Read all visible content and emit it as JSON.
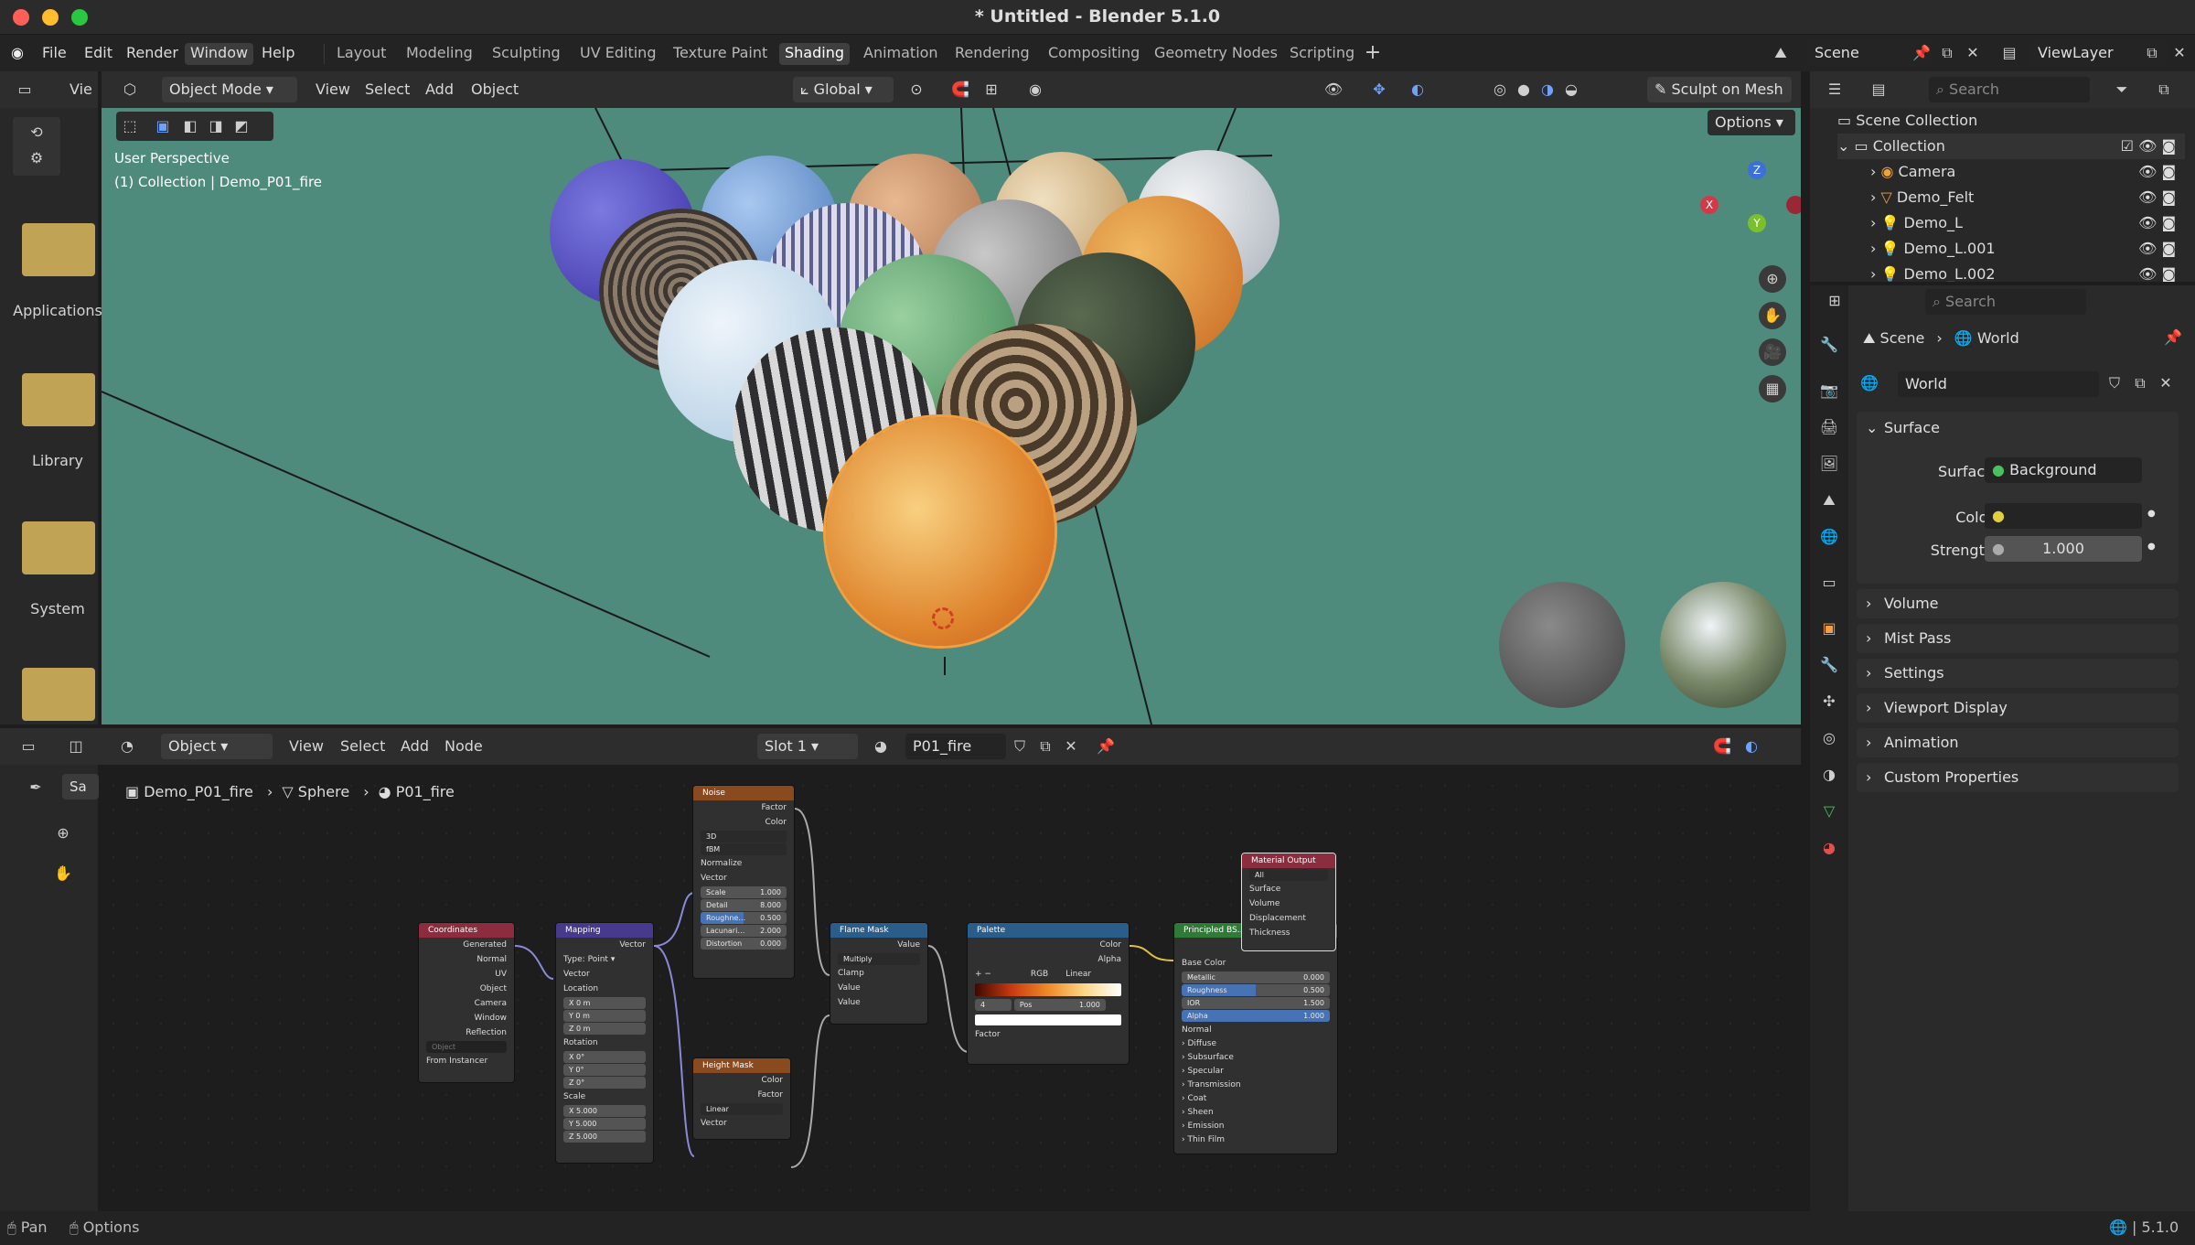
{
  "window": {
    "title": "* Untitled - Blender 5.1.0"
  },
  "menu": {
    "items": [
      "File",
      "Edit",
      "Render",
      "Window",
      "Help"
    ],
    "active": "Window"
  },
  "workspaces": [
    "Layout",
    "Modeling",
    "Sculpting",
    "UV Editing",
    "Texture Paint",
    "Shading",
    "Animation",
    "Rendering",
    "Compositing",
    "Geometry Nodes",
    "Scripting"
  ],
  "active_workspace": "Shading",
  "scene": {
    "name": "Scene",
    "view_layer": "ViewLayer"
  },
  "left_panel": {
    "header_label": "Vie",
    "folders": [
      "Applications",
      "Library",
      "System"
    ]
  },
  "viewport": {
    "mode": "Object Mode",
    "menus": [
      "View",
      "Select",
      "Add",
      "Object"
    ],
    "orientation": "Global",
    "sculpt_label": "Sculpt on Mesh",
    "options": "Options",
    "overlay_line1": "User Perspective",
    "overlay_line2": "(1) Collection | Demo_P01_fire",
    "gizmo": {
      "x": "X",
      "y": "Y",
      "z": "Z"
    }
  },
  "node_editor": {
    "editor_type": "Object",
    "menus": [
      "View",
      "Select",
      "Add",
      "Node"
    ],
    "slot": "Slot 1",
    "material": "P01_fire",
    "breadcrumb": [
      "Demo_P01_fire",
      "Sphere",
      "P01_fire"
    ],
    "side_tab": "Sa",
    "nodes": {
      "coordinates": {
        "title": "Coordinates",
        "outputs": [
          "Generated",
          "Normal",
          "UV",
          "Object",
          "Camera",
          "Window",
          "Reflection"
        ],
        "object_placeholder": "Object",
        "from_instancer": "From Instancer"
      },
      "mapping": {
        "title": "Mapping",
        "output": "Vector",
        "type_label": "Type:",
        "type_value": "Point",
        "vector": "Vector",
        "location": "Location",
        "loc": [
          "X  0 m",
          "Y  0 m",
          "Z  0 m"
        ],
        "rotation": "Rotation",
        "rot": [
          "X  0°",
          "Y  0°",
          "Z  0°"
        ],
        "scale": "Scale",
        "scl": [
          "X  5.000",
          "Y  5.000",
          "Z  5.000"
        ]
      },
      "noise": {
        "title": "Noise",
        "outputs": [
          "Factor",
          "Color"
        ],
        "dim": "3D",
        "type": "fBM",
        "normalize": "Normalize",
        "vector": "Vector",
        "fields": [
          {
            "l": "Scale",
            "v": "1.000"
          },
          {
            "l": "Detail",
            "v": "8.000"
          },
          {
            "l": "Roughne…",
            "v": "0.500"
          },
          {
            "l": "Lacunari…",
            "v": "2.000"
          },
          {
            "l": "Distortion",
            "v": "0.000"
          }
        ]
      },
      "height_mask": {
        "title": "Height Mask",
        "outputs": [
          "Color",
          "Factor"
        ],
        "interp": "Linear",
        "vector": "Vector"
      },
      "flame_mask": {
        "title": "Flame Mask",
        "output": "Value",
        "blend": "Multiply",
        "clamp": "Clamp",
        "inputs": [
          "Value",
          "Value"
        ]
      },
      "palette": {
        "title": "Palette",
        "outputs": [
          "Color",
          "Alpha"
        ],
        "mode": "RGB",
        "interp": "Linear",
        "index": "4",
        "pos_label": "Pos",
        "pos_value": "1.000",
        "factor": "Factor"
      },
      "principled": {
        "title": "Principled BS…",
        "base_color": "Base Color",
        "fields": [
          {
            "l": "Metallic",
            "v": "0.000"
          },
          {
            "l": "Roughness",
            "v": "0.500"
          },
          {
            "l": "IOR",
            "v": "1.500"
          },
          {
            "l": "Alpha",
            "v": "1.000"
          }
        ],
        "normal": "Normal",
        "sections": [
          "Diffuse",
          "Subsurface",
          "Specular",
          "Transmission",
          "Coat",
          "Sheen",
          "Emission",
          "Thin Film"
        ]
      },
      "output": {
        "title": "Material Output",
        "target": "All",
        "inputs": [
          "Surface",
          "Volume",
          "Displacement",
          "Thickness"
        ]
      }
    }
  },
  "outliner": {
    "search_placeholder": "Search",
    "root": "Scene Collection",
    "collection": "Collection",
    "items": [
      "Camera",
      "Demo_Felt",
      "Demo_L",
      "Demo_L.001",
      "Demo_L.002"
    ]
  },
  "properties": {
    "search_placeholder": "Search",
    "breadcrumb": [
      "Scene",
      "World"
    ],
    "world": "World",
    "surface_panel": "Surface",
    "surface_label": "Surface",
    "surface_value": "Background",
    "color_label": "Color",
    "strength_label": "Strength",
    "strength_value": "1.000",
    "panels": [
      "Volume",
      "Mist Pass",
      "Settings",
      "Viewport Display",
      "Animation",
      "Custom Properties"
    ]
  },
  "status": {
    "pan": "Pan",
    "options": "Options",
    "version": "5.1.0"
  },
  "colors": {
    "accent": "#4772b3",
    "viewport_bg": "#4f8b7d",
    "node_texture": "#8a4a1f",
    "node_vector": "#473a8c",
    "node_input": "#8c2d3f",
    "node_converter": "#2a5d8a",
    "node_shader": "#2e7a36"
  }
}
